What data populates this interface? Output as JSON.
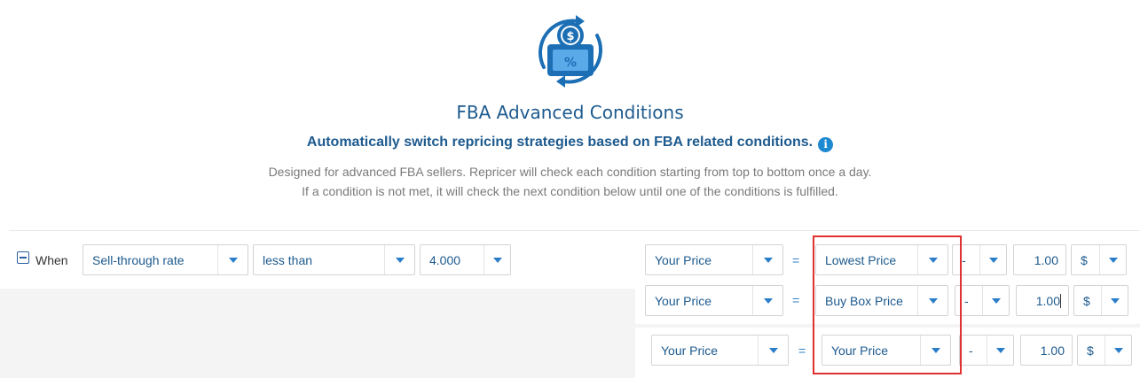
{
  "header": {
    "logo_icon": "price-tag-cycle-icon",
    "title": "FBA Advanced Conditions",
    "subtitle": "Automatically switch repricing strategies based on FBA related conditions.",
    "info_icon_glyph": "i",
    "description_line1": "Designed for advanced FBA sellers. Repricer will check each condition starting from top to bottom once a day.",
    "description_line2": "If a condition is not met, it will check the next condition below until one of the conditions is fulfilled."
  },
  "condition": {
    "when_label": "When",
    "metric": "Sell-through rate",
    "operator": "less than",
    "threshold": "4.000"
  },
  "rules": [
    {
      "target": "Your Price",
      "equals": "=",
      "base": "Lowest Price",
      "modifier": "-",
      "amount": "1.00",
      "unit": "$"
    },
    {
      "target": "Your Price",
      "equals": "=",
      "base": "Buy Box Price",
      "modifier": "-",
      "amount": "1.00",
      "unit": "$"
    },
    {
      "target": "Your Price",
      "equals": "=",
      "base": "Your Price",
      "modifier": "-",
      "amount": "1.00",
      "unit": "$"
    }
  ],
  "colors": {
    "title": "#1d5a8e",
    "accent": "#2a7dc9",
    "highlight_box": "#e03030"
  }
}
